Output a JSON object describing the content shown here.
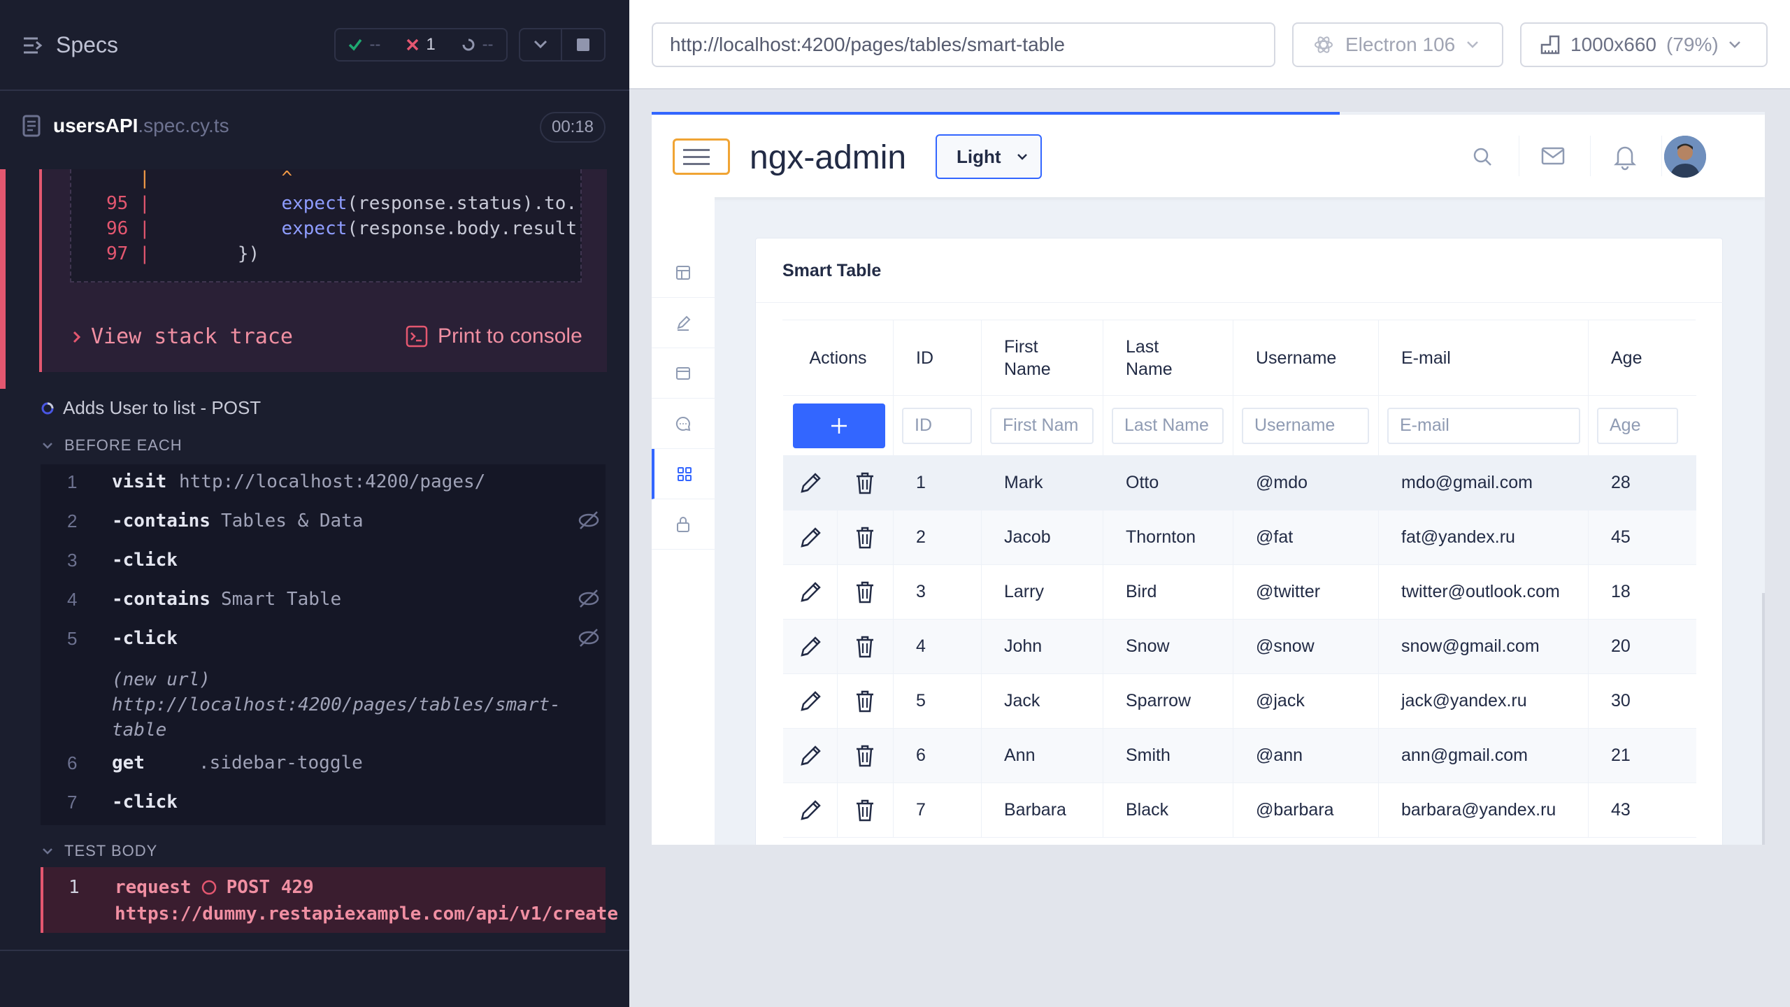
{
  "reporter": {
    "specs_label": "Specs",
    "stats": {
      "passed": "--",
      "failed": "1",
      "pending": "--"
    },
    "spec_file": {
      "name": "usersAPI",
      "ext": ".spec.cy.ts"
    },
    "duration": "00:18",
    "code_frame": {
      "caret_line": "|            ^",
      "lines": [
        {
          "num": "95",
          "code_pre": "|            ",
          "fn": "expect",
          "code_post": "(response.status).to."
        },
        {
          "num": "96",
          "code_pre": "|            ",
          "fn": "expect",
          "code_post": "(response.body.result"
        },
        {
          "num": "97",
          "code_pre": "|        ",
          "fn": "",
          "code_post": "})"
        }
      ]
    },
    "view_stack_trace": "View stack trace",
    "print_to_console": "Print to console",
    "test_title": "Adds User to list - POST",
    "before_each": {
      "title": "BEFORE EACH",
      "commands": [
        {
          "num": "1",
          "cmd": "visit",
          "arg": "http://localhost:4200/pages/",
          "hidden": false
        },
        {
          "num": "2",
          "cmd": "-contains",
          "arg": "Tables & Data",
          "hidden": true
        },
        {
          "num": "3",
          "cmd": "-click",
          "arg": "",
          "hidden": false
        },
        {
          "num": "4",
          "cmd": "-contains",
          "arg": "Smart Table",
          "hidden": true
        },
        {
          "num": "5",
          "cmd": "-click",
          "arg": "",
          "hidden": true
        },
        {
          "num": "6",
          "cmd": "get",
          "arg": ".sidebar-toggle",
          "hidden": false
        },
        {
          "num": "7",
          "cmd": "-click",
          "arg": "",
          "hidden": false
        }
      ],
      "new_url_label": "(new url)",
      "new_url": "http://localhost:4200/pages/tables/smart-table"
    },
    "test_body": {
      "title": "TEST BODY",
      "num": "1",
      "cmd": "request",
      "status": "POST 429",
      "url": "https://dummy.restapiexample.com/api/v1/create"
    }
  },
  "browser": {
    "url": "http://localhost:4200/pages/tables/smart-table",
    "engine": "Electron 106",
    "viewport": "1000x660",
    "zoom": "(79%)"
  },
  "app": {
    "logo": "ngx-admin",
    "theme": "Light",
    "card_title": "Smart Table",
    "columns": [
      "Actions",
      "ID",
      "First Name",
      "Last Name",
      "Username",
      "E-mail",
      "Age"
    ],
    "filters": [
      "ID",
      "First Nam",
      "Last Name",
      "Username",
      "E-mail",
      "Age"
    ],
    "rows": [
      {
        "id": "1",
        "first": "Mark",
        "last": "Otto",
        "username": "@mdo",
        "email": "mdo@gmail.com",
        "age": "28"
      },
      {
        "id": "2",
        "first": "Jacob",
        "last": "Thornton",
        "username": "@fat",
        "email": "fat@yandex.ru",
        "age": "45"
      },
      {
        "id": "3",
        "first": "Larry",
        "last": "Bird",
        "username": "@twitter",
        "email": "twitter@outlook.com",
        "age": "18"
      },
      {
        "id": "4",
        "first": "John",
        "last": "Snow",
        "username": "@snow",
        "email": "snow@gmail.com",
        "age": "20"
      },
      {
        "id": "5",
        "first": "Jack",
        "last": "Sparrow",
        "username": "@jack",
        "email": "jack@yandex.ru",
        "age": "30"
      },
      {
        "id": "6",
        "first": "Ann",
        "last": "Smith",
        "username": "@ann",
        "email": "ann@gmail.com",
        "age": "21"
      },
      {
        "id": "7",
        "first": "Barbara",
        "last": "Black",
        "username": "@barbara",
        "email": "barbara@yandex.ru",
        "age": "43"
      }
    ]
  }
}
